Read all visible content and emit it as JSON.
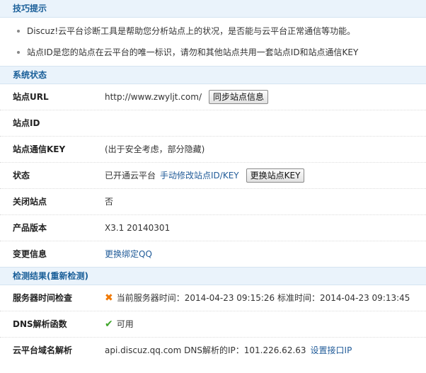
{
  "tips": {
    "title": "技巧提示",
    "items": [
      "Discuz!云平台诊断工具是帮助您分析站点上的状况，是否能与云平台正常通信等功能。",
      "站点ID是您的站点在云平台的唯一标识，请勿和其他站点共用一套站点ID和站点通信KEY"
    ]
  },
  "status": {
    "title": "系统状态",
    "site_url_label": "站点URL",
    "site_url_value": "http://www.zwyljt.com/",
    "sync_button": "同步站点信息",
    "site_id_label": "站点ID",
    "site_id_value": "",
    "comm_key_label": "站点通信KEY",
    "comm_key_value": "(出于安全考虑，部分隐藏)",
    "state_label": "状态",
    "state_value": "已开通云平台",
    "state_link": "手动修改站点ID/KEY",
    "change_key_button": "更换站点KEY",
    "close_label": "关闭站点",
    "close_value": "否",
    "version_label": "产品版本",
    "version_value": "X3.1 20140301",
    "change_label": "变更信息",
    "change_link": "更换绑定QQ"
  },
  "check": {
    "title": "检测结果",
    "recheck": "(重新检测)",
    "time_label": "服务器时间检查",
    "time_value": "当前服务器时间：2014-04-23 09:15:26 标准时间：2014-04-23 09:13:45",
    "dns_label": "DNS解析函数",
    "dns_value": "可用",
    "domain_label": "云平台域名解析",
    "domain_value": "api.discuz.qq.com DNS解析的IP：101.226.62.63",
    "domain_link": "设置接口IP"
  },
  "icons": {
    "fail": "cross-icon",
    "ok": "check-icon",
    "fail_color": "#f07800",
    "ok_color": "#3fa52a"
  }
}
